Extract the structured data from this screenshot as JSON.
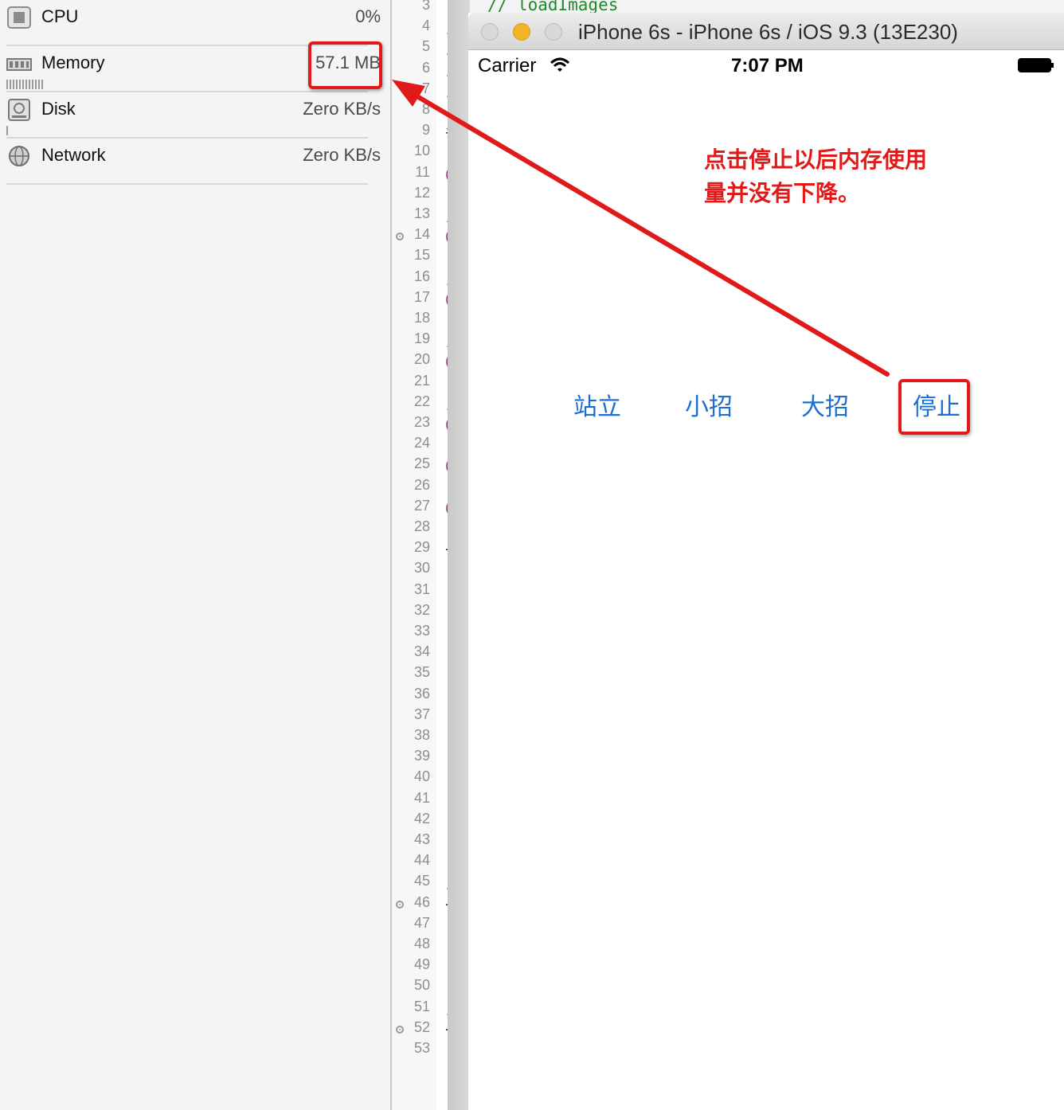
{
  "gauges": [
    {
      "label": "CPU",
      "value": "0%",
      "icon": "cpu-icon"
    },
    {
      "label": "Memory",
      "value": "57.1 MB",
      "icon": "memory-chip-icon"
    },
    {
      "label": "Disk",
      "value": "Zero KB/s",
      "icon": "disk-icon"
    },
    {
      "label": "Network",
      "value": "Zero KB/s",
      "icon": "network-globe-icon"
    }
  ],
  "editor": {
    "top_comment": "//   loadImages",
    "line_numbers": [
      "3",
      "4",
      "5",
      "6",
      "7",
      "8",
      "9",
      "10",
      "11",
      "12",
      "13",
      "14",
      "15",
      "16",
      "17",
      "18",
      "19",
      "20",
      "21",
      "22",
      "23",
      "24",
      "25",
      "26",
      "27",
      "28",
      "29",
      "30",
      "31",
      "32",
      "33",
      "34",
      "35",
      "36",
      "37",
      "38",
      "39",
      "40",
      "41",
      "42",
      "43",
      "44",
      "45",
      "46",
      "47",
      "48",
      "49",
      "50",
      "51",
      "52",
      "53"
    ],
    "code_fragments": [
      {
        "line": "4",
        "text": "//",
        "kind": "comment"
      },
      {
        "line": "5",
        "text": "//",
        "kind": "comment"
      },
      {
        "line": "6",
        "text": "//",
        "kind": "comment"
      },
      {
        "line": "7",
        "text": "//",
        "kind": "comment"
      },
      {
        "line": "9",
        "text": "#i",
        "kind": "directive"
      },
      {
        "line": "11",
        "text": "@i",
        "kind": "keyword"
      },
      {
        "line": "13",
        "text": "//",
        "kind": "comment"
      },
      {
        "line": "14",
        "text": "@p",
        "kind": "keyword"
      },
      {
        "line": "16",
        "text": "/*",
        "kind": "comment"
      },
      {
        "line": "17",
        "text": "@p",
        "kind": "keyword"
      },
      {
        "line": "19",
        "text": "/*",
        "kind": "comment"
      },
      {
        "line": "20",
        "text": "@p",
        "kind": "keyword"
      },
      {
        "line": "22",
        "text": "/*",
        "kind": "comment"
      },
      {
        "line": "23",
        "text": "@p",
        "kind": "keyword"
      },
      {
        "line": "25",
        "text": "@e",
        "kind": "keyword"
      },
      {
        "line": "27",
        "text": "@i",
        "kind": "keyword"
      },
      {
        "line": "29",
        "text": "–",
        "kind": "plain"
      },
      {
        "line": "43",
        "text": "}",
        "kind": "plain"
      },
      {
        "line": "45",
        "text": "//",
        "kind": "comment"
      },
      {
        "line": "46",
        "text": "–",
        "kind": "plain"
      },
      {
        "line": "49",
        "text": "}",
        "kind": "plain"
      },
      {
        "line": "51",
        "text": "//",
        "kind": "comment"
      },
      {
        "line": "52",
        "text": "–",
        "kind": "plain"
      }
    ],
    "breakpoint_lines": [
      "14",
      "46",
      "52"
    ]
  },
  "simulator": {
    "window_title": "iPhone 6s - iPhone 6s / iOS 9.3 (13E230)",
    "status_bar": {
      "carrier": "Carrier",
      "time": "7:07 PM"
    },
    "buttons": {
      "stand": "站立",
      "small_skill": "小招",
      "ultimate": "大招",
      "stop": "停止"
    }
  },
  "annotation": {
    "line1": "点击停止以后内存使用",
    "line2": "量并没有下降。",
    "color": "#e01a1a"
  },
  "colors": {
    "ios_tint": "#1a6fd1",
    "comment_green": "#1f8a2a",
    "keyword_purple": "#9b2393"
  }
}
